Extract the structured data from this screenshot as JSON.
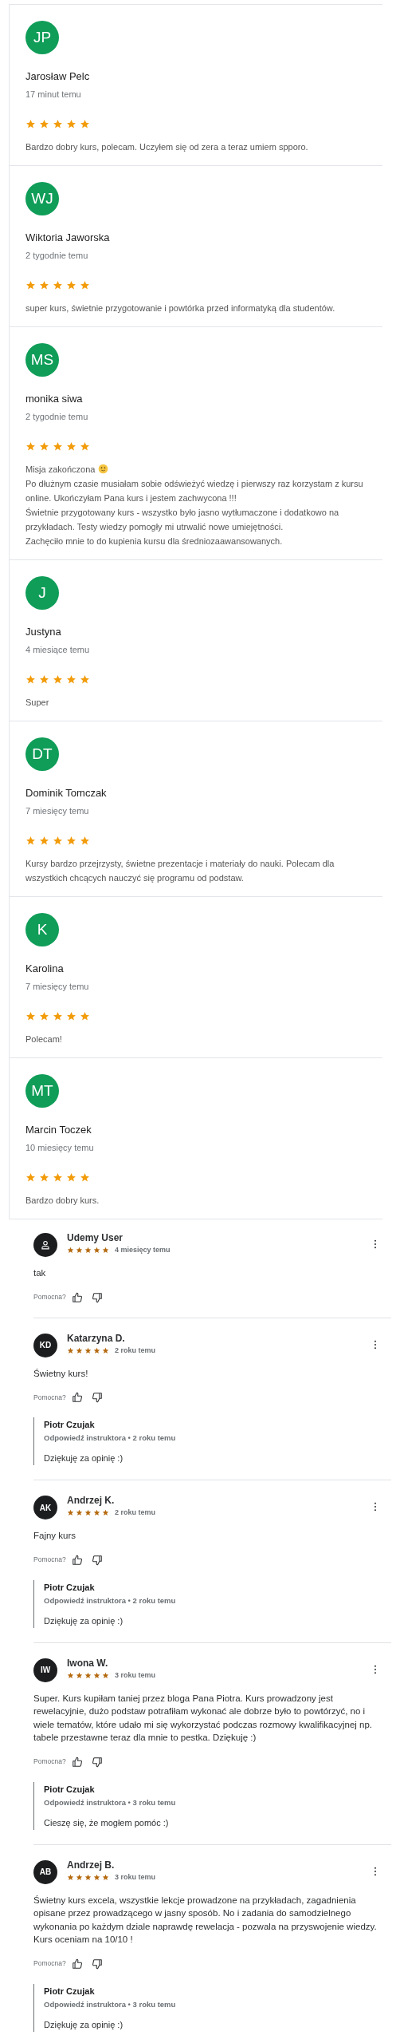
{
  "reviews": [
    {
      "initials": "JP",
      "name": "Jarosław Pelc",
      "date": "17 minut temu",
      "stars": 5,
      "paragraphs": [
        {
          "text": "Bardzo dobry kurs, polecam. Uczyłem się od zera a teraz umiem spporo.",
          "smiley": false
        }
      ]
    },
    {
      "initials": "WJ",
      "name": "Wiktoria Jaworska",
      "date": "2 tygodnie temu",
      "stars": 5,
      "paragraphs": [
        {
          "text": "super kurs, świetnie przygotowanie i powtórka przed informatyką dla studentów.",
          "smiley": false
        }
      ]
    },
    {
      "initials": "MS",
      "name": "monika siwa",
      "date": "2 tygodnie temu",
      "stars": 5,
      "paragraphs": [
        {
          "text": "Misja zakończona",
          "smiley": true
        },
        {
          "text": "Po dłużnym czasie musiałam sobie odświeżyć wiedzę i pierwszy raz korzystam z kursu online. Ukończyłam Pana kurs i jestem zachwycona !!!",
          "smiley": false
        },
        {
          "text": "Świetnie przygotowany kurs - wszystko było jasno wytłumaczone i dodatkowo na przykładach. Testy wiedzy pomogły mi utrwalić nowe umiejętności.",
          "smiley": false
        },
        {
          "text": "Zachęciło mnie to do kupienia kursu dla średniozaawansowanych.",
          "smiley": false
        }
      ]
    },
    {
      "initials": "J",
      "name": "Justyna",
      "date": "4 miesiące temu",
      "stars": 5,
      "paragraphs": [
        {
          "text": "Super",
          "smiley": false
        }
      ]
    },
    {
      "initials": "DT",
      "name": "Dominik Tomczak",
      "date": "7 miesięcy temu",
      "stars": 5,
      "paragraphs": [
        {
          "text": "Kursy bardzo przejrzysty, świetne prezentacje i materiały do nauki. Polecam dla wszystkich chcących nauczyć się programu od podstaw.",
          "smiley": false
        }
      ]
    },
    {
      "initials": "K",
      "name": "Karolina",
      "date": "7 miesięcy temu",
      "stars": 5,
      "paragraphs": [
        {
          "text": "Polecam!",
          "smiley": false
        }
      ]
    },
    {
      "initials": "MT",
      "name": "Marcin Toczek",
      "date": "10 miesięcy temu",
      "stars": 5,
      "paragraphs": [
        {
          "text": "Bardzo dobry kurs.",
          "smiley": false
        }
      ]
    }
  ],
  "udemy_reviews": [
    {
      "avatar": {
        "kind": "icon"
      },
      "name": "Udemy User",
      "stars": 5,
      "date": "4 miesięcy temu",
      "text": "tak",
      "helpful_label": "Pomocna?"
    },
    {
      "avatar": {
        "kind": "initials",
        "text": "KD"
      },
      "name": "Katarzyna D.",
      "stars": 5,
      "date": "2 roku temu",
      "text": "Świetny kurs!",
      "helpful_label": "Pomocna?",
      "reply": {
        "name": "Piotr Czujak",
        "meta": "Odpowiedź instruktora • 2 roku temu",
        "text": "Dziękuję za opinię :)"
      }
    },
    {
      "avatar": {
        "kind": "initials",
        "text": "AK"
      },
      "name": "Andrzej K.",
      "stars": 5,
      "date": "2 roku temu",
      "text": "Fajny kurs",
      "helpful_label": "Pomocna?",
      "reply": {
        "name": "Piotr Czujak",
        "meta": "Odpowiedź instruktora • 2 roku temu",
        "text": "Dziękuję za opinię :)"
      }
    },
    {
      "avatar": {
        "kind": "initials",
        "text": "IW"
      },
      "name": "Iwona W.",
      "stars": 5,
      "date": "3 roku temu",
      "text": "Super. Kurs kupiłam taniej przez bloga Pana Piotra. Kurs prowadzony jest rewelacyjnie, dużo podstaw potrafiłam wykonać ale dobrze było to powtórzyć, no i wiele tematów, które udało mi się wykorzystać podczas rozmowy kwalifikacyjnej np. tabele przestawne teraz dla mnie to pestka. Dziękuję :)",
      "helpful_label": "Pomocna?",
      "reply": {
        "name": "Piotr Czujak",
        "meta": "Odpowiedź instruktora • 3 roku temu",
        "text": "Cieszę się, że mogłem pomóc :)"
      }
    },
    {
      "avatar": {
        "kind": "initials",
        "text": "AB"
      },
      "name": "Andrzej B.",
      "stars": 5,
      "date": "3 roku temu",
      "text": "Świetny kurs excela, wszystkie lekcje prowadzone na przykładach, zagadnienia opisane przez prowadzącego w jasny sposób. No i zadania do samodzielnego wykonania po każdym dziale naprawdę rewelacja - pozwala na przyswojenie wiedzy. Kurs oceniam na 10/10 !",
      "helpful_label": "Pomocna?",
      "reply": {
        "name": "Piotr Czujak",
        "meta": "Odpowiedź instruktora • 3 roku temu",
        "text": "Dziękuję za opinię :)"
      }
    }
  ]
}
